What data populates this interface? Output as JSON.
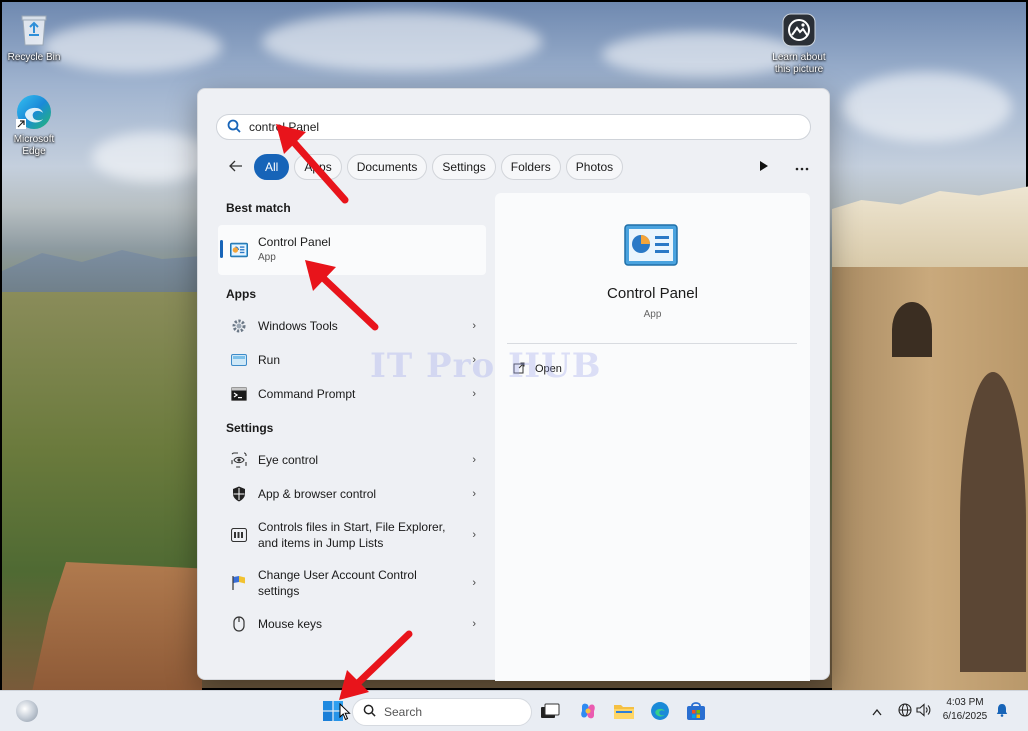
{
  "desktop": {
    "icons": [
      {
        "label": "Recycle Bin"
      },
      {
        "label": "Microsoft Edge"
      },
      {
        "label": "Learn about this picture"
      }
    ]
  },
  "search": {
    "query": "control Panel",
    "placeholder": ""
  },
  "filters": {
    "chips": [
      "All",
      "Apps",
      "Documents",
      "Settings",
      "Folders",
      "Photos"
    ],
    "active": "All"
  },
  "best_match": {
    "heading": "Best match",
    "title": "Control Panel",
    "subtitle": "App"
  },
  "apps": {
    "heading": "Apps",
    "items": [
      {
        "label": "Windows Tools"
      },
      {
        "label": "Run"
      },
      {
        "label": "Command Prompt"
      }
    ]
  },
  "settings": {
    "heading": "Settings",
    "items": [
      {
        "label": "Eye control"
      },
      {
        "label": "App & browser control"
      },
      {
        "label_line1": "Controls files in Start, File Explorer,",
        "label_line2": "and items in Jump Lists"
      },
      {
        "label_line1": "Change User Account Control",
        "label_line2": "settings"
      },
      {
        "label": "Mouse keys"
      }
    ]
  },
  "preview": {
    "title": "Control Panel",
    "subtitle": "App",
    "action": "Open"
  },
  "watermark": "IT Pro HUB",
  "taskbar": {
    "search_label": "Search",
    "time": "4:03 PM",
    "date": "6/16/2025"
  },
  "colors": {
    "accent": "#1764b8",
    "arrow": "#e8141b",
    "panel_bg": "#eef0f4",
    "taskbar_bg": "#e9edf3"
  }
}
